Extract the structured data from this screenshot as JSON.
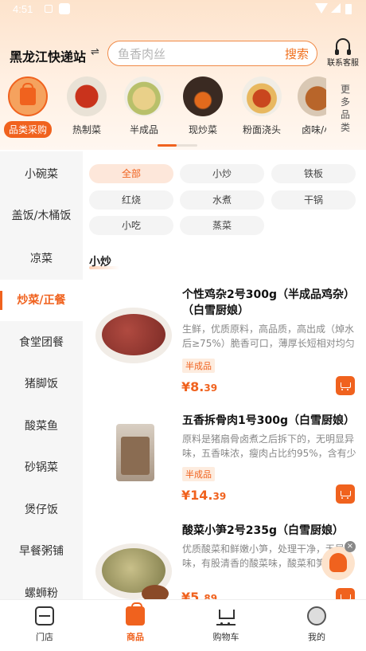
{
  "status_bar": {
    "time": "4:51"
  },
  "header": {
    "location": "黑龙江快递站",
    "switch_icon": "⇌",
    "search_placeholder": "鱼香肉丝",
    "search_button": "搜索",
    "service_label": "联系客服"
  },
  "categories": [
    {
      "label": "品类采购",
      "icon": "shop-basket",
      "active": true
    },
    {
      "label": "热制菜",
      "icon": "cooked-dish"
    },
    {
      "label": "半成品",
      "icon": "semi-product"
    },
    {
      "label": "现炒菜",
      "icon": "stir-fry"
    },
    {
      "label": "粉面浇头",
      "icon": "noodle-topping"
    },
    {
      "label": "卤味/小",
      "icon": "braised"
    }
  ],
  "more_categories": "更多品类",
  "sidebar": {
    "items": [
      "小碗菜",
      "盖饭/木桶饭",
      "凉菜",
      "炒菜/正餐",
      "食堂团餐",
      "猪脚饭",
      "酸菜鱼",
      "砂锅菜",
      "煲仔饭",
      "早餐粥铺",
      "螺蛳粉"
    ],
    "active_index": 3
  },
  "filters": {
    "chips": [
      "全部",
      "小炒",
      "铁板",
      "红烧",
      "水煮",
      "干锅",
      "小吃",
      "蒸菜"
    ],
    "active_index": 0
  },
  "section_title": "小炒",
  "products": [
    {
      "title": "个性鸡杂2号300g（半成品鸡杂）（白雪厨娘）",
      "desc": "生鲜，优质原料，高品质，高出成（焯水后≥75%）脆香可口，薄厚长短相对均匀",
      "tag": "半成品",
      "price_int": "¥8.",
      "price_cents": "39"
    },
    {
      "title": "五香拆骨肉1号300g（白雪厨娘）",
      "desc": "原料是猪扇骨卤煮之后拆下的，无明显异味，五香味浓，瘦肉占比约95%，含有少量筋膜",
      "tag": "半成品",
      "price_int": "¥14.",
      "price_cents": "39"
    },
    {
      "title": "酸菜小笋2号235g（白雪厨娘）",
      "desc": "优质酸菜和鲜嫩小笋，处理干净，无异味，有股清香的酸菜味，酸菜和笋脆嫩",
      "tag": "",
      "price_int": "¥5.",
      "price_cents": "89"
    }
  ],
  "float_close": "×",
  "bottom_nav": [
    {
      "label": "门店",
      "icon": "store-icon"
    },
    {
      "label": "商品",
      "icon": "bag-icon",
      "active": true
    },
    {
      "label": "购物车",
      "icon": "cart-icon"
    },
    {
      "label": "我的",
      "icon": "mine-icon"
    }
  ],
  "colors": {
    "accent": "#f0621e",
    "header_bg": "#fde3cc"
  }
}
